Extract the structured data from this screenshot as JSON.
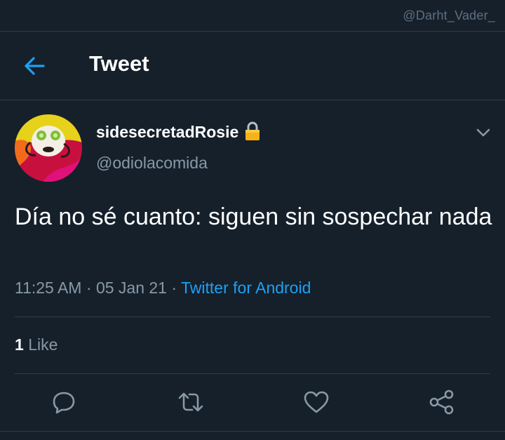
{
  "watermark": "@Darht_Vader_",
  "header": {
    "title": "Tweet",
    "back_icon": "arrow-left-icon"
  },
  "tweet": {
    "author": {
      "display_name": "sidesecretadRosie",
      "handle": "@odiolacomida",
      "protected_icon": "lock-icon",
      "avatar_caption": "sidesecretadRosie"
    },
    "text": "Día no sé cuanto: siguen sin sospechar nada",
    "time": "11:25 AM",
    "separator": "·",
    "date": "05 Jan 21",
    "source": "Twitter for Android",
    "likes_count": "1",
    "likes_label": "Like"
  },
  "actions": [
    {
      "name": "reply",
      "icon": "reply-icon"
    },
    {
      "name": "retweet",
      "icon": "retweet-icon"
    },
    {
      "name": "like",
      "icon": "heart-icon"
    },
    {
      "name": "share",
      "icon": "share-icon"
    }
  ],
  "colors": {
    "background": "#15202b",
    "divider": "#2f3b47",
    "accent": "#1da1f2",
    "secondary_text": "#8899a6",
    "watermark": "#5d6f80"
  }
}
